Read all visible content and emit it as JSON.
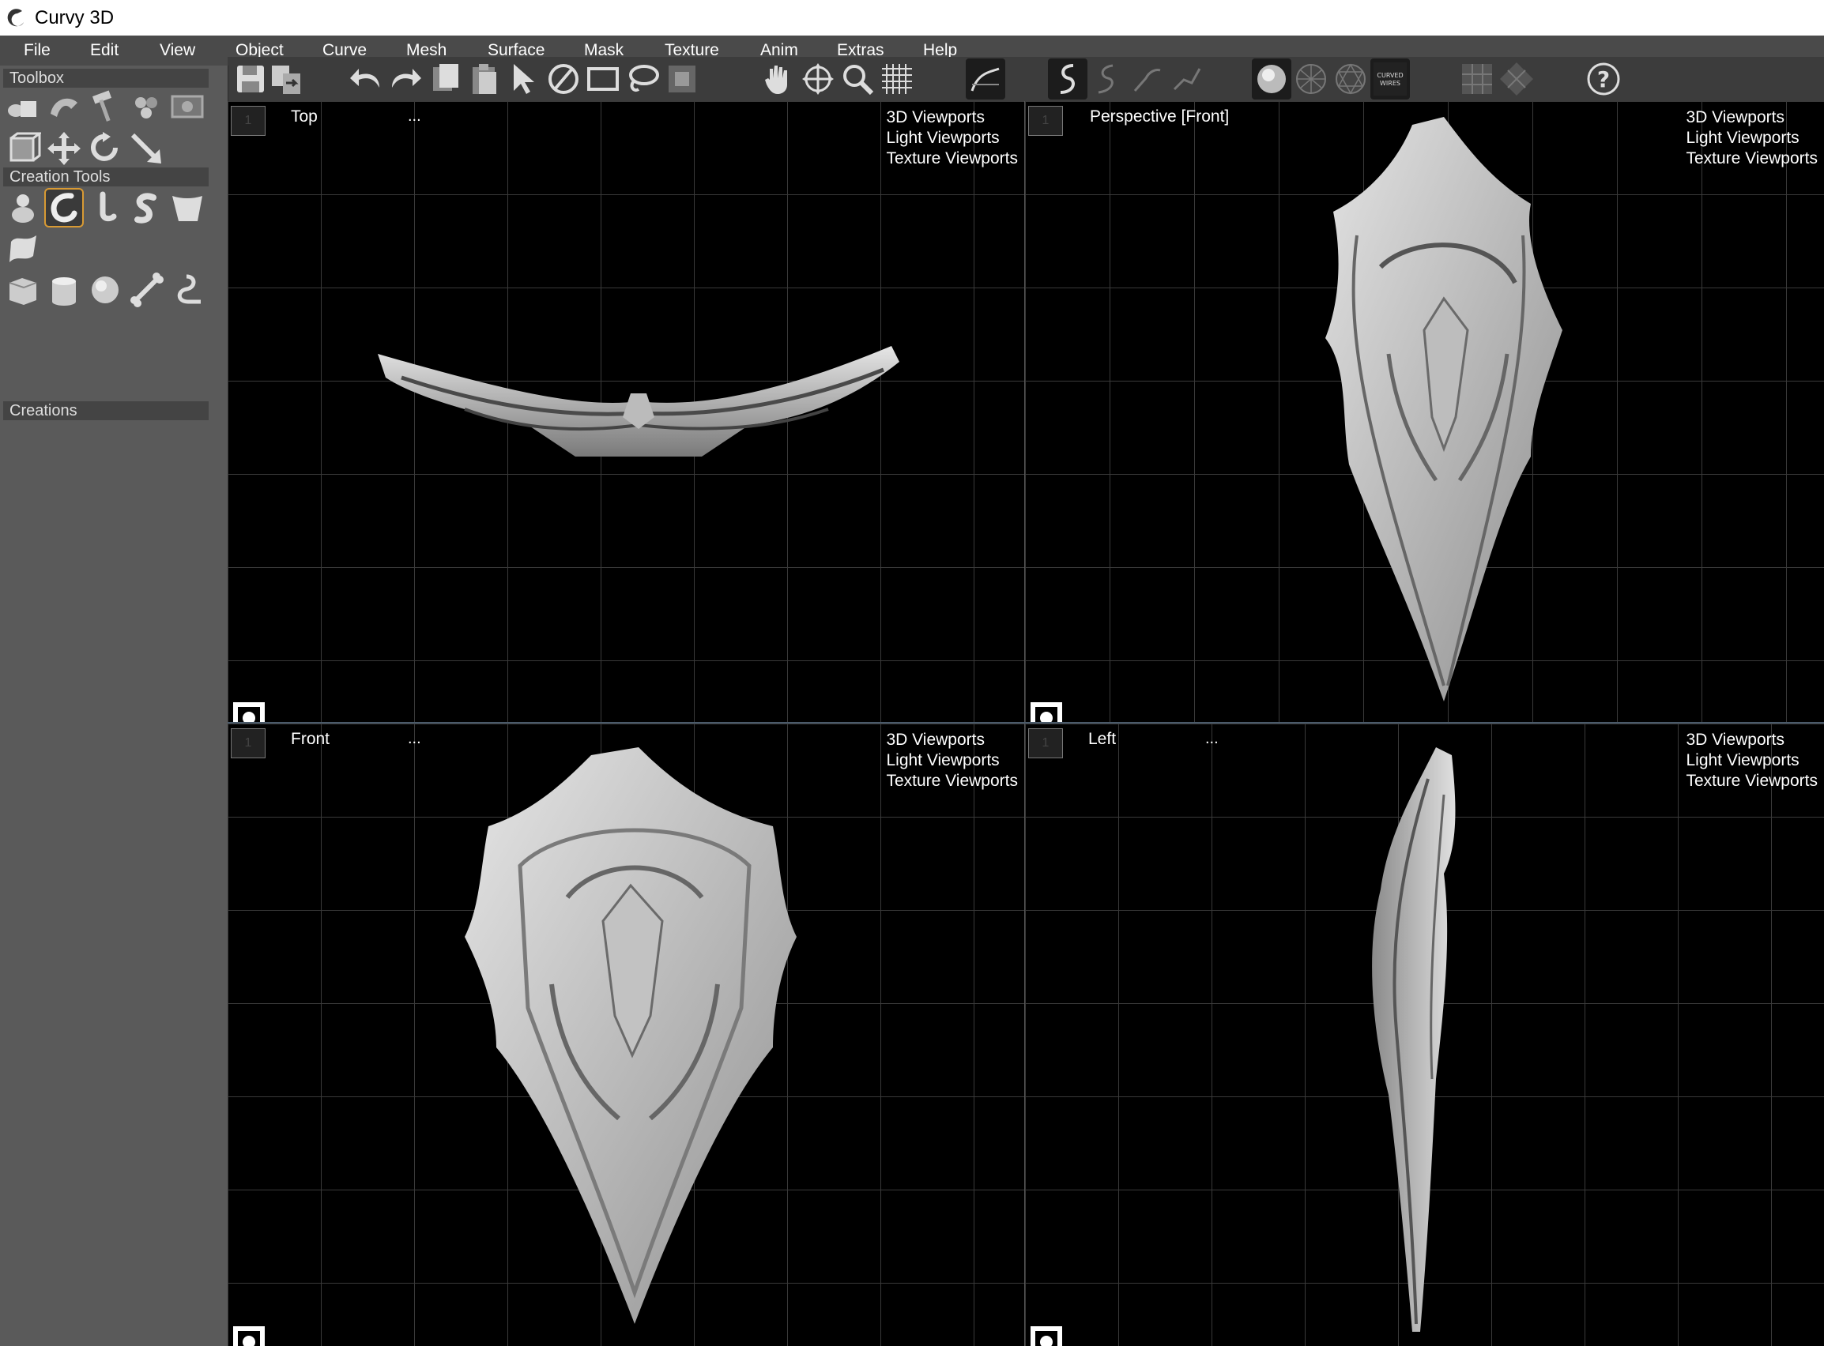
{
  "window": {
    "title": "Curvy 3D"
  },
  "menu": [
    "File",
    "Edit",
    "View",
    "Object",
    "Curve",
    "Mesh",
    "Surface",
    "Mask",
    "Texture",
    "Anim",
    "Extras",
    "Help"
  ],
  "toolbar": {
    "icons": [
      "save-icon",
      "export-icon",
      "undo-icon",
      "redo-icon",
      "copy-icon",
      "paste-icon",
      "select-arrow-icon",
      "deselect-icon",
      "rect-select-icon",
      "lasso-select-icon",
      "mask-select-icon",
      "pan-hand-icon",
      "move-view-icon",
      "zoom-icon",
      "grid-icon",
      "edit-curve-icon",
      "curve-tool-1-icon",
      "curve-tool-2-icon",
      "curve-tool-3-icon",
      "curve-tool-4-icon",
      "shaded-sphere-icon",
      "wireframe-sphere-icon",
      "wire-sphere-2-icon",
      "curved-wires-icon",
      "flat-grid-icon",
      "diamond-grid-icon",
      "help-icon"
    ],
    "curved_wires_label": "CURVED WIRES"
  },
  "left_panel": {
    "toolbox_header": "Toolbox",
    "creation_header": "Creation Tools",
    "creations_header": "Creations"
  },
  "viewports": [
    {
      "id": "top",
      "title": "Top",
      "more": "...",
      "links": [
        "3D Viewports",
        "Light Viewports",
        "Texture Viewports"
      ],
      "num": "1"
    },
    {
      "id": "perspective",
      "title": "Perspective [Front]",
      "more": "",
      "links": [
        "3D Viewports",
        "Light Viewports",
        "Texture Viewports"
      ],
      "num": "1"
    },
    {
      "id": "front",
      "title": "Front",
      "more": "...",
      "links": [
        "3D Viewports",
        "Light Viewports",
        "Texture Viewports"
      ],
      "num": "1"
    },
    {
      "id": "left",
      "title": "Left",
      "more": "...",
      "links": [
        "3D Viewports",
        "Light Viewports",
        "Texture Viewports"
      ],
      "num": "1"
    }
  ],
  "colors": {
    "panel": "#5a5a5a",
    "menubar": "#4a4a4a",
    "active_tool": "#d89a34",
    "model": "#c8c8c8"
  }
}
